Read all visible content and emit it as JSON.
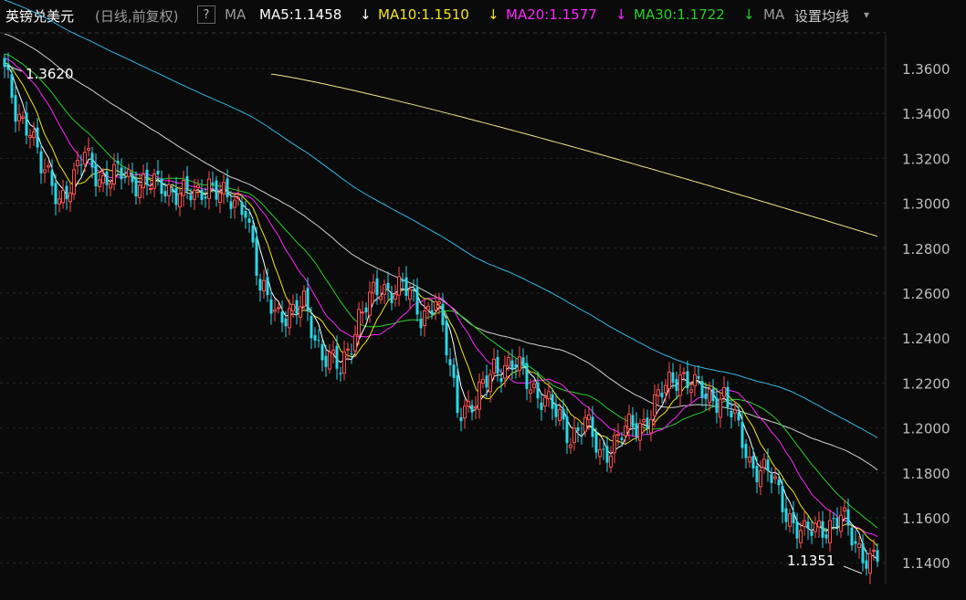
{
  "header": {
    "title": "英镑兑美元",
    "mode": "(日线,前复权)",
    "help": "?",
    "ma_label": "MA",
    "ma5": "MA5:1.1458",
    "ma10": "MA10:1.1510",
    "ma20": "MA20:1.1577",
    "ma30": "MA30:1.1722",
    "ma_more": "MA",
    "settings": "设置均线",
    "arrow": "↓",
    "dropdown": "▾"
  },
  "colors": {
    "up": "#ff4d4d",
    "down": "#29d7e6",
    "ma5": "#ffffff",
    "ma10": "#f2e61a",
    "ma20": "#ff26ff",
    "ma30": "#27d127",
    "ma60": "#cfcfcf",
    "ma120": "#33b6e6",
    "ma250": "#efe98a"
  },
  "chart_data": {
    "type": "candlestick",
    "ylim": [
      1.132,
      1.37
    ],
    "yticks": [
      "1.3600",
      "1.3400",
      "1.3200",
      "1.3000",
      "1.2800",
      "1.2600",
      "1.2400",
      "1.2200",
      "1.2000",
      "1.1800",
      "1.1600",
      "1.1400"
    ],
    "max_label": "1.3620",
    "min_label": "1.1351",
    "anchors": [
      [
        0,
        1.358
      ],
      [
        3,
        1.34
      ],
      [
        7,
        1.335
      ],
      [
        10,
        1.315
      ],
      [
        15,
        1.303
      ],
      [
        19,
        1.31
      ],
      [
        22,
        1.322
      ],
      [
        27,
        1.31
      ],
      [
        33,
        1.313
      ],
      [
        39,
        1.308
      ],
      [
        45,
        1.307
      ],
      [
        52,
        1.302
      ],
      [
        56,
        1.31
      ],
      [
        61,
        1.3
      ],
      [
        66,
        1.3
      ],
      [
        70,
        1.26
      ],
      [
        75,
        1.252
      ],
      [
        79,
        1.25
      ],
      [
        82,
        1.255
      ],
      [
        87,
        1.233
      ],
      [
        92,
        1.225
      ],
      [
        97,
        1.25
      ],
      [
        103,
        1.262
      ],
      [
        109,
        1.263
      ],
      [
        114,
        1.25
      ],
      [
        118,
        1.258
      ],
      [
        124,
        1.21
      ],
      [
        129,
        1.21
      ],
      [
        134,
        1.228
      ],
      [
        140,
        1.227
      ],
      [
        144,
        1.22
      ],
      [
        149,
        1.21
      ],
      [
        155,
        1.197
      ],
      [
        159,
        1.202
      ],
      [
        163,
        1.188
      ],
      [
        169,
        1.197
      ],
      [
        175,
        1.203
      ],
      [
        179,
        1.213
      ],
      [
        185,
        1.225
      ],
      [
        192,
        1.213
      ],
      [
        197,
        1.215
      ],
      [
        200,
        1.202
      ],
      [
        204,
        1.185
      ],
      [
        209,
        1.18
      ],
      [
        214,
        1.163
      ],
      [
        219,
        1.152
      ],
      [
        225,
        1.157
      ],
      [
        229,
        1.16
      ],
      [
        233,
        1.148
      ],
      [
        237,
        1.142
      ]
    ]
  }
}
